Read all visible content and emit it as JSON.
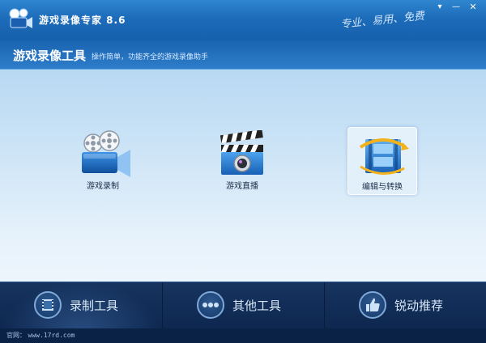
{
  "window": {
    "title": "游戏录像专家 8.6",
    "slogan": "专业、易用、免费",
    "controls": {
      "menu": "▾",
      "minimize": "—",
      "close": "✕"
    }
  },
  "header": {
    "title": "游戏录像工具",
    "subtitle": "操作简单，功能齐全的游戏录像助手"
  },
  "tools": [
    {
      "label": "游戏录制",
      "icon": "film-camera-icon"
    },
    {
      "label": "游戏直播",
      "icon": "clapperboard-icon"
    },
    {
      "label": "编辑与转换",
      "icon": "film-convert-icon",
      "selected": true
    }
  ],
  "bottom_nav": [
    {
      "label": "录制工具",
      "icon": "film-strip-icon",
      "active": true
    },
    {
      "label": "其他工具",
      "icon": "more-dots-icon"
    },
    {
      "label": "锐动推荐",
      "icon": "thumbs-up-icon"
    }
  ],
  "statusbar": {
    "prefix": "官网：",
    "url": "www.17rd.com"
  },
  "colors": {
    "titlebar": "#1d6cb9",
    "bottom_nav": "#12305a",
    "accent": "#2e7dc9"
  }
}
